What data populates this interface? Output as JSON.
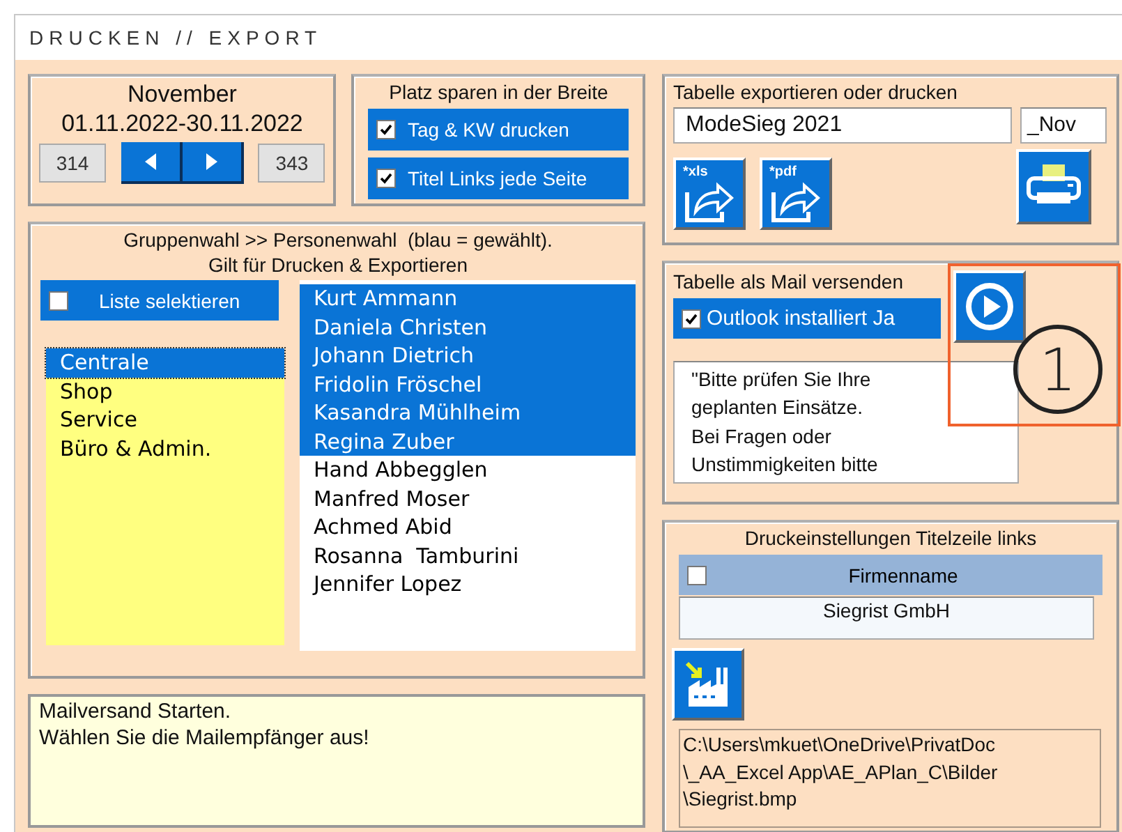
{
  "window": {
    "title": "DRUCKEN // EXPORT"
  },
  "period": {
    "month": "November",
    "range": "01.11.2022-30.11.2022",
    "start_number": "314",
    "end_number": "343"
  },
  "width_saving": {
    "title": "Platz sparen in der Breite",
    "options": [
      {
        "label": "Tag & KW drucken",
        "checked": true
      },
      {
        "label": "Titel Links jede Seite",
        "checked": true
      }
    ]
  },
  "selection": {
    "title": "Gruppenwahl >> Personenwahl  (blau = gewählt).",
    "subtitle": "Gilt für Drucken & Exportieren",
    "select_list": {
      "label": "Liste selektieren",
      "checked": false
    },
    "groups": [
      {
        "label": "Centrale",
        "selected": true
      },
      {
        "label": "Shop",
        "selected": false
      },
      {
        "label": "Service",
        "selected": false
      },
      {
        "label": "Büro & Admin.",
        "selected": false
      }
    ],
    "persons": [
      {
        "label": "Kurt Ammann",
        "selected": true
      },
      {
        "label": "Daniela Christen",
        "selected": true
      },
      {
        "label": "Johann Dietrich",
        "selected": true
      },
      {
        "label": "Fridolin Fröschel",
        "selected": true
      },
      {
        "label": "Kasandra Mühlheim",
        "selected": true
      },
      {
        "label": "Regina Zuber",
        "selected": true
      },
      {
        "label": "Hand Abbegglen",
        "selected": false
      },
      {
        "label": "Manfred Moser",
        "selected": false
      },
      {
        "label": "Achmed Abid",
        "selected": false
      },
      {
        "label": "Rosanna  Tamburini",
        "selected": false
      },
      {
        "label": "Jennifer Lopez",
        "selected": false
      }
    ]
  },
  "message": {
    "lines": [
      "Mailversand Starten.",
      "Wählen Sie die Mailempfänger aus!"
    ]
  },
  "export": {
    "title": "Tabelle exportieren oder drucken",
    "file_name": "ModeSieg 2021",
    "suffix": "_Nov",
    "buttons": [
      {
        "kind": "export",
        "label": "*xls"
      },
      {
        "kind": "export",
        "label": "*pdf"
      }
    ]
  },
  "mail": {
    "title": "Tabelle als Mail versenden",
    "outlook": {
      "label": "Outlook installiert Ja",
      "checked": true
    },
    "body_lines": [
      "\"Bitte prüfen Sie Ihre",
      "geplanten Einsätze.",
      "Bei Fragen oder",
      "Unstimmigkeiten bitte"
    ]
  },
  "annotation": {
    "label": "1"
  },
  "header_settings": {
    "title": "Druckeinstellungen Titelzeile links",
    "company": {
      "label": "Firmenname",
      "checked": false
    },
    "company_name": "Siegrist GmbH",
    "logo_path_lines": [
      "C:\\Users\\mkuet\\OneDrive\\PrivatDoc",
      "\\_AA_Excel App\\AE_APlan_C\\Bilder",
      "\\Siegrist.bmp"
    ]
  }
}
